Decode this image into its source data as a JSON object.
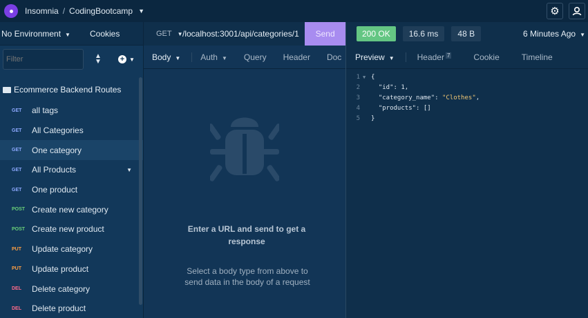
{
  "topbar": {
    "app_name": "Insomnia",
    "workspace": "CodingBootcamp",
    "icons": [
      "gear-icon",
      "account-icon"
    ]
  },
  "sidebar": {
    "environment": "No Environment",
    "cookies": "Cookies",
    "filter_placeholder": "Filter",
    "folder": "Ecommerce Backend Routes",
    "requests": [
      {
        "method": "GET",
        "name": "all tags"
      },
      {
        "method": "GET",
        "name": "All Categories"
      },
      {
        "method": "GET",
        "name": "One category"
      },
      {
        "method": "GET",
        "name": "All Products"
      },
      {
        "method": "GET",
        "name": "One product"
      },
      {
        "method": "POST",
        "name": "Create new category"
      },
      {
        "method": "POST",
        "name": "Create new product"
      },
      {
        "method": "PUT",
        "name": "Update category"
      },
      {
        "method": "PUT",
        "name": "Update product"
      },
      {
        "method": "DEL",
        "name": "Delete category"
      },
      {
        "method": "DEL",
        "name": "Delete product"
      }
    ]
  },
  "request": {
    "method": "GET",
    "url": "/localhost:3001/api/categories/1",
    "send": "Send",
    "tabs": [
      "Body",
      "Auth",
      "Query",
      "Header",
      "Doc"
    ],
    "empty_title": "Enter a URL and send to get a response",
    "empty_sub": "Select a body type from above to send data in the body of a request"
  },
  "response": {
    "status": "200 OK",
    "time": "16.6 ms",
    "size": "48 B",
    "time_ago": "6 Minutes Ago",
    "tabs": [
      "Preview",
      "Header",
      "Cookie",
      "Timeline"
    ],
    "header_count": "7",
    "lines": [
      "1",
      "2",
      "3",
      "4",
      "5"
    ],
    "json": {
      "open": "{",
      "id_key": "\"id\"",
      "id_val": "1",
      "cat_key": "\"category_name\"",
      "cat_val": "\"Clothes\"",
      "prod_key": "\"products\"",
      "prod_val": "[]",
      "close": "}"
    }
  },
  "colors": {
    "accent": "#a88cf0",
    "status_ok": "#64c683",
    "method_get": "#8da9ff",
    "method_post": "#6ad079",
    "method_put": "#ff9f43",
    "method_del": "#ff6b8a"
  }
}
